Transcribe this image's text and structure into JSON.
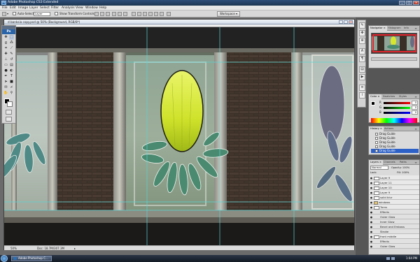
{
  "app": {
    "title": "Adobe Photoshop CS3 Extended",
    "logo": "Ps",
    "window_buttons": [
      "_",
      "□",
      "×"
    ]
  },
  "menu": [
    "File",
    "Edit",
    "Image",
    "Layer",
    "Select",
    "Filter",
    "Analysis",
    "View",
    "Window",
    "Help"
  ],
  "options_bar": {
    "auto_select_label": "Auto-Select:",
    "auto_select_value": "Layer",
    "show_transform_label": "Show Transform Controls",
    "workspace_label": "Workspace ▾"
  },
  "document": {
    "title": "d banksia copy.psd @ 50% (Background, RGB/8*)",
    "zoom": "50%",
    "doc_size": "Doc: 18.7M/307.3M"
  },
  "panels": {
    "navigator": {
      "tabs": [
        "Navigator ×",
        "Histogram",
        "Info"
      ]
    },
    "color": {
      "tabs": [
        "Color ×",
        "Swatches",
        "Styles"
      ],
      "rows": [
        {
          "label": "R",
          "value": "0"
        },
        {
          "label": "G",
          "value": "0"
        },
        {
          "label": "B",
          "value": "0"
        }
      ]
    },
    "history": {
      "tabs": [
        "History ×",
        "Actions"
      ],
      "items": [
        "Drag Guide",
        "Drag Guide",
        "Drag Guide",
        "Drag Guide",
        "Drag Guide"
      ]
    },
    "layers": {
      "tabs": [
        "Layers ×",
        "Channels",
        "Paths"
      ],
      "blend_mode": "Normal",
      "opacity": "Opacity: 100%",
      "lock_label": "Lock:",
      "fill": "Fill: 100%",
      "rows": [
        {
          "name": "Layer 9",
          "type": "layer"
        },
        {
          "name": "Layer 11",
          "type": "layer"
        },
        {
          "name": "Layer 10",
          "type": "layer"
        },
        {
          "name": "Layer 9",
          "type": "layer"
        },
        {
          "name": "solid blur",
          "type": "layer"
        },
        {
          "name": "windows",
          "type": "group"
        },
        {
          "name": "Turns",
          "type": "layer"
        },
        {
          "name": "Effects",
          "type": "fx"
        },
        {
          "name": "Outer Glow",
          "type": "fx"
        },
        {
          "name": "Inner Glow",
          "type": "fx"
        },
        {
          "name": "Bevel and Emboss",
          "type": "fx"
        },
        {
          "name": "Stroke",
          "type": "fx"
        },
        {
          "name": "front middle",
          "type": "layer"
        },
        {
          "name": "Effects",
          "type": "fx"
        },
        {
          "name": "Outer Glow",
          "type": "fx"
        }
      ]
    }
  },
  "taskbar": {
    "task_label": "Adobe Photoshop C...",
    "clock": "1:04 PM"
  },
  "colors": {
    "accent": "#2d61c7",
    "titlebar": "#1d3553",
    "guide": "#5ad5d5"
  }
}
